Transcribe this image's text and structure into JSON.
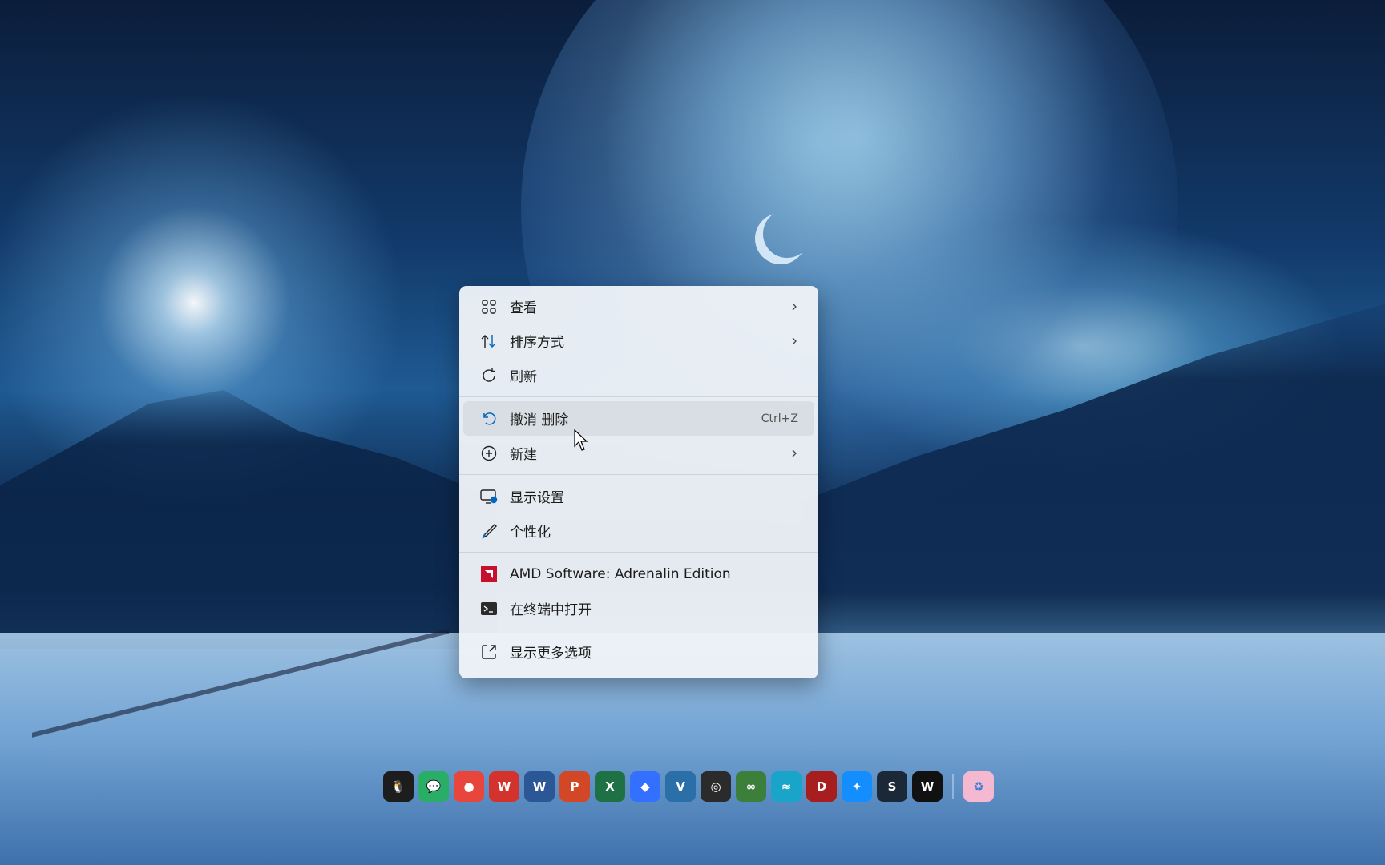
{
  "context_menu": {
    "items": [
      {
        "id": "view",
        "label": "查看",
        "icon": "grid-icon",
        "submenu": true
      },
      {
        "id": "sort",
        "label": "排序方式",
        "icon": "sort-icon",
        "submenu": true
      },
      {
        "id": "refresh",
        "label": "刷新",
        "icon": "refresh-icon"
      },
      {
        "id": "undo",
        "label": "撤消 删除",
        "icon": "undo-icon",
        "shortcut": "Ctrl+Z",
        "hovered": true
      },
      {
        "id": "new",
        "label": "新建",
        "icon": "plus-circle-icon",
        "submenu": true
      },
      {
        "id": "display",
        "label": "显示设置",
        "icon": "display-settings-icon"
      },
      {
        "id": "personalize",
        "label": "个性化",
        "icon": "brush-icon"
      },
      {
        "id": "amd",
        "label": "AMD Software: Adrenalin Edition",
        "icon": "amd-icon"
      },
      {
        "id": "terminal",
        "label": "在终端中打开",
        "icon": "terminal-icon"
      },
      {
        "id": "more",
        "label": "显示更多选项",
        "icon": "more-options-icon"
      }
    ],
    "colors": {
      "background": "#eef2f7",
      "amd_red": "#c8102e"
    }
  },
  "dock": {
    "icons": [
      {
        "name": "qq-icon",
        "glyph": "🐧",
        "color": "#1d1d1d"
      },
      {
        "name": "wechat-icon",
        "glyph": "💬",
        "color": "#2aae67"
      },
      {
        "name": "chrome-icon",
        "glyph": "●",
        "color": "#e8453c"
      },
      {
        "name": "wps-icon",
        "glyph": "W",
        "color": "#d4322c"
      },
      {
        "name": "word-icon",
        "glyph": "W",
        "color": "#2b5797"
      },
      {
        "name": "powerpoint-icon",
        "glyph": "P",
        "color": "#d24726"
      },
      {
        "name": "excel-icon",
        "glyph": "X",
        "color": "#1e7145"
      },
      {
        "name": "feishu-icon",
        "glyph": "◆",
        "color": "#3370ff"
      },
      {
        "name": "vtb-icon",
        "glyph": "V",
        "color": "#2a6fa8"
      },
      {
        "name": "obs-icon",
        "glyph": "◎",
        "color": "#2b2b2b"
      },
      {
        "name": "hub-icon",
        "glyph": "∞",
        "color": "#3c7f3b"
      },
      {
        "name": "wifi-icon",
        "glyph": "≈",
        "color": "#18a5c9"
      },
      {
        "name": "dota-icon",
        "glyph": "D",
        "color": "#a61e1e"
      },
      {
        "name": "battlenet-icon",
        "glyph": "✦",
        "color": "#148eff"
      },
      {
        "name": "steam-icon",
        "glyph": "S",
        "color": "#1b2838"
      },
      {
        "name": "wolf-icon",
        "glyph": "W",
        "color": "#111111"
      }
    ],
    "recycle_bin": {
      "name": "recycle-bin-icon",
      "glyph": "♻",
      "color": "#f4b8d0"
    }
  }
}
